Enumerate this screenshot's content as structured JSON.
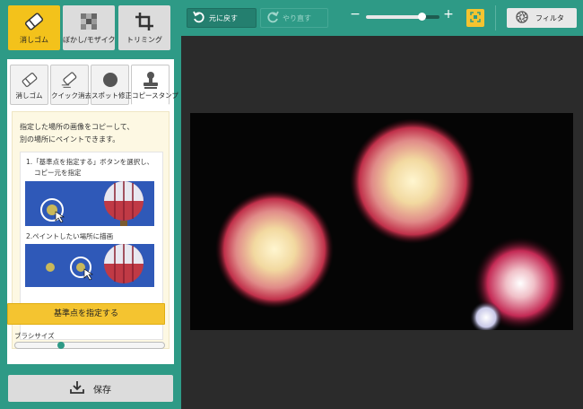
{
  "top_tabs": [
    {
      "label": "消しゴム",
      "icon": "eraser-icon"
    },
    {
      "label": "ぼかし/モザイク",
      "icon": "mosaic-icon"
    },
    {
      "label": "トリミング",
      "icon": "crop-icon"
    }
  ],
  "sub_tabs": [
    {
      "label": "消しゴム",
      "icon": "eraser-icon"
    },
    {
      "label": "クイック消去",
      "icon": "quick-erase-icon"
    },
    {
      "label": "スポット修正",
      "icon": "spot-fix-icon"
    },
    {
      "label": "コピースタンプ",
      "icon": "stamp-icon"
    }
  ],
  "info": {
    "text_line1": "指定した場所の画像をコピーして、",
    "text_line2": "別の場所にペイントできます。",
    "step1_line1": "1.「基準点を指定する」ボタンを選択し、",
    "step1_line2": "コピー元を指定",
    "step2": "2.ペイントしたい場所に描画"
  },
  "set_base_button": "基準点を指定する",
  "brush_size": {
    "label": "ブラシサイズ",
    "value": 0.3
  },
  "save_button": "保存",
  "toolbar": {
    "undo": "元に戻す",
    "redo": "やり直す",
    "zoom_minus": "−",
    "zoom_plus": "+",
    "zoom_level": 0.76,
    "filter": "フィルタ"
  },
  "colors": {
    "teal": "#2e9a86",
    "yellow": "#f4c430",
    "dark_bg": "#2b2b2b"
  }
}
